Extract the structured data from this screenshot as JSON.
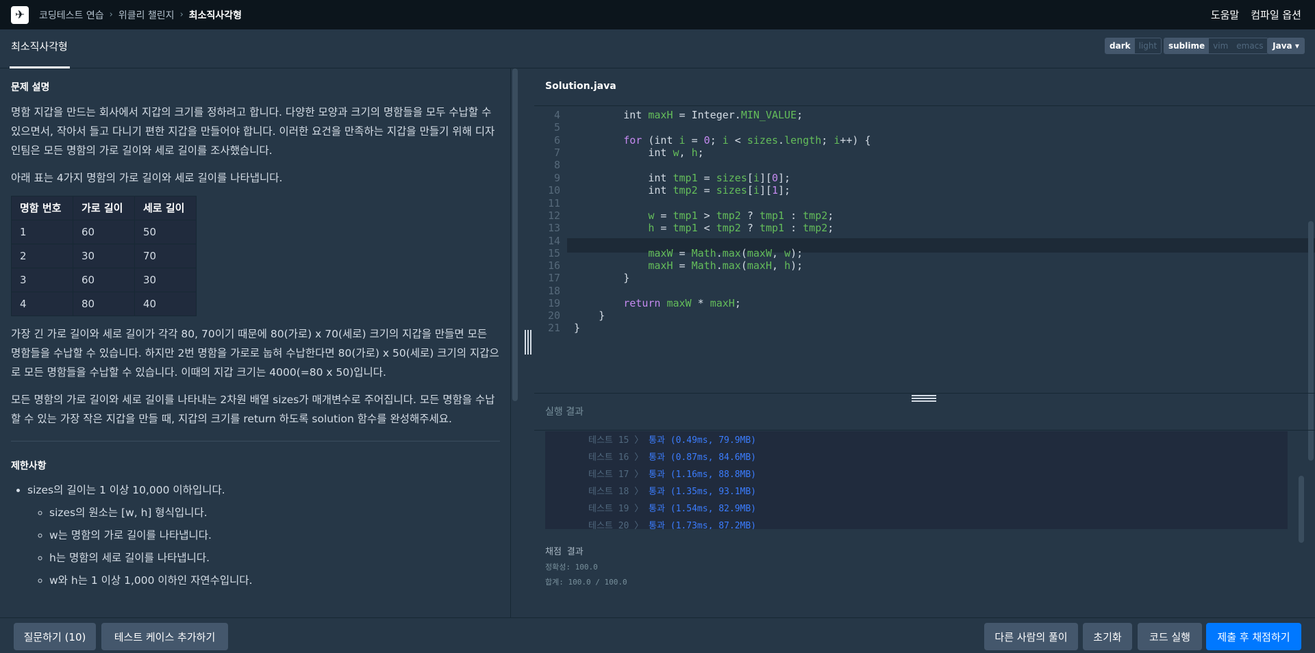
{
  "topbar": {
    "crumbs": [
      "코딩테스트 연습",
      "위클리 챌린지"
    ],
    "current": "최소직사각형",
    "help": "도움말",
    "compile_options": "컴파일 옵션"
  },
  "subbar": {
    "problem_tab": "최소직사각형",
    "theme": [
      "dark",
      "light"
    ],
    "keymap": [
      "sublime",
      "vim",
      "emacs"
    ],
    "language": "Java"
  },
  "problem": {
    "section1": "문제 설명",
    "p1": "명함 지갑을 만드는 회사에서 지갑의 크기를 정하려고 합니다. 다양한 모양과 크기의 명함들을 모두 수납할 수 있으면서, 작아서 들고 다니기 편한 지갑을 만들어야 합니다. 이러한 요건을 만족하는 지갑을 만들기 위해 디자인팀은 모든 명함의 가로 길이와 세로 길이를 조사했습니다.",
    "p2": "아래 표는 4가지 명함의 가로 길이와 세로 길이를 나타냅니다.",
    "table": {
      "headers": [
        "명함 번호",
        "가로 길이",
        "세로 길이"
      ],
      "rows": [
        [
          "1",
          "60",
          "50"
        ],
        [
          "2",
          "30",
          "70"
        ],
        [
          "3",
          "60",
          "30"
        ],
        [
          "4",
          "80",
          "40"
        ]
      ]
    },
    "p3": "가장 긴 가로 길이와 세로 길이가 각각 80, 70이기 때문에 80(가로) x 70(세로) 크기의 지갑을 만들면 모든 명함들을 수납할 수 있습니다. 하지만 2번 명함을 가로로 눕혀 수납한다면 80(가로) x 50(세로) 크기의 지갑으로 모든 명함들을 수납할 수 있습니다. 이때의 지갑 크기는 4000(=80 x 50)입니다.",
    "p4": "모든 명함의 가로 길이와 세로 길이를 나타내는 2차원 배열 sizes가 매개변수로 주어집니다. 모든 명함을 수납할 수 있는 가장 작은 지갑을 만들 때, 지갑의 크기를 return 하도록 solution 함수를 완성해주세요.",
    "section2": "제한사항",
    "c1": "sizes의 길이는 1 이상 10,000 이하입니다.",
    "c2": "sizes의 원소는 [w, h] 형식입니다.",
    "c3": "w는 명함의 가로 길이를 나타냅니다.",
    "c4": "h는 명함의 세로 길이를 나타냅니다.",
    "c5": "w와 h는 1 이상 1,000 이하인 자연수입니다."
  },
  "editor": {
    "filename": "Solution.java",
    "line_numbers": [
      "4",
      "5",
      "6",
      "7",
      "8",
      "9",
      "10",
      "11",
      "12",
      "13",
      "14",
      "15",
      "16",
      "17",
      "18",
      "19",
      "20",
      "21"
    ]
  },
  "results": {
    "title": "실행 결과",
    "tests": [
      {
        "label": "테스트 15",
        "result": "통과 (0.49ms, 79.9MB)"
      },
      {
        "label": "테스트 16",
        "result": "통과 (0.87ms, 84.6MB)"
      },
      {
        "label": "테스트 17",
        "result": "통과 (1.16ms, 88.8MB)"
      },
      {
        "label": "테스트 18",
        "result": "통과 (1.35ms, 93.1MB)"
      },
      {
        "label": "테스트 19",
        "result": "통과 (1.54ms, 82.9MB)"
      },
      {
        "label": "테스트 20",
        "result": "통과 (1.73ms, 87.2MB)"
      }
    ],
    "grade_title": "채점 결과",
    "accuracy": "정확성: 100.0",
    "total": "합계: 100.0 / 100.0"
  },
  "bottom": {
    "question": "질문하기 (10)",
    "add_testcase": "테스트 케이스 추가하기",
    "others": "다른 사람의 풀이",
    "reset": "초기화",
    "run": "코드 실행",
    "submit": "제출 후 채점하기"
  }
}
